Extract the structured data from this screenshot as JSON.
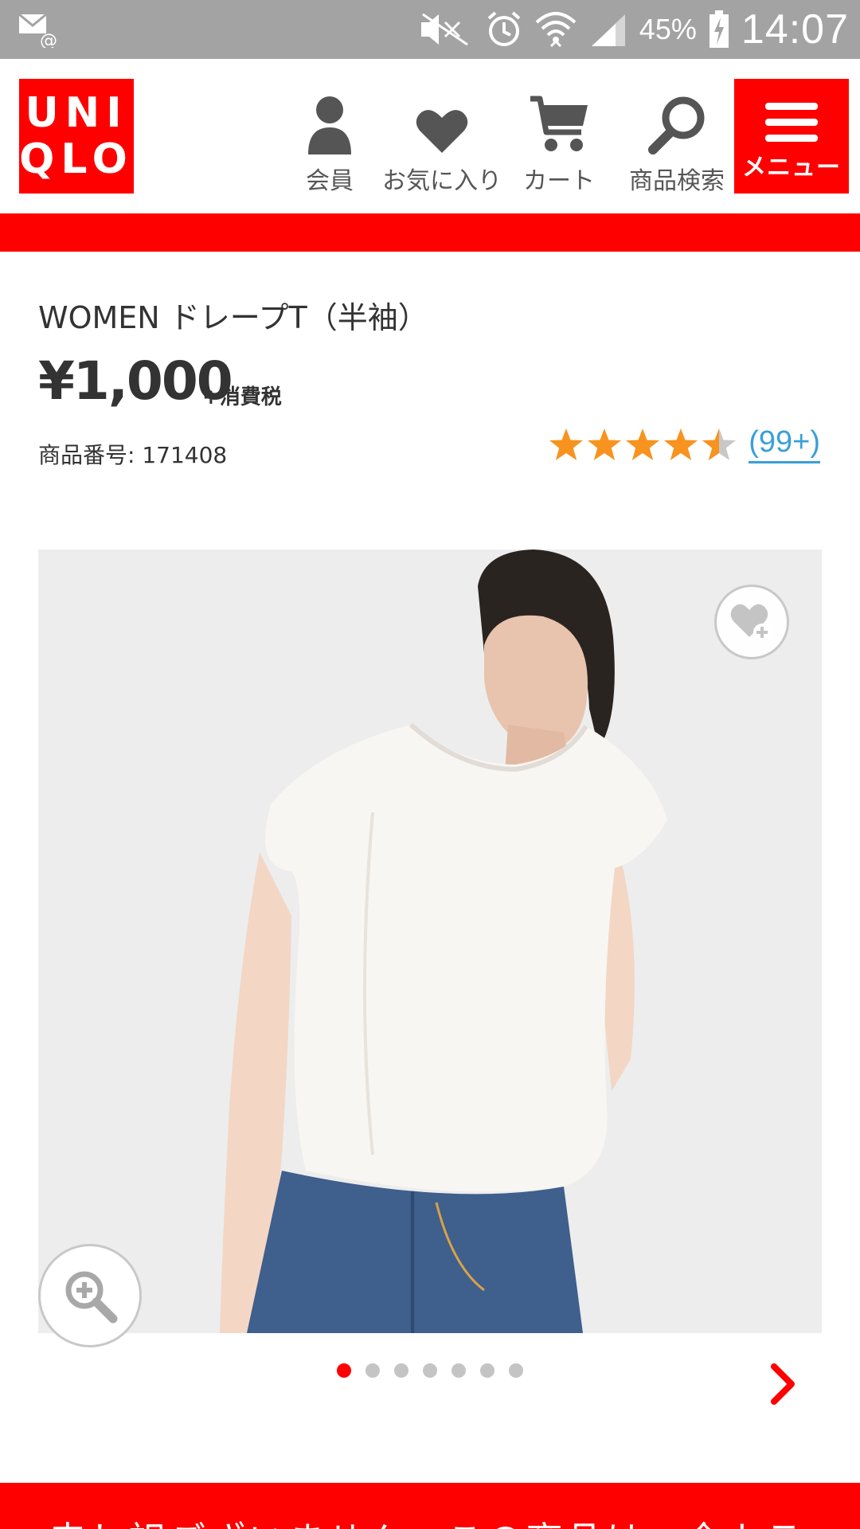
{
  "status_bar": {
    "battery": "45%",
    "time": "14:07"
  },
  "brand": {
    "logo_line1": "UNI",
    "logo_line2": "QLO",
    "color": "#ff0000"
  },
  "header_nav": [
    {
      "label": "会員",
      "icon": "person-icon"
    },
    {
      "label": "お気に入り",
      "icon": "heart-icon"
    },
    {
      "label": "カート",
      "icon": "cart-icon"
    },
    {
      "label": "商品検索",
      "icon": "search-icon"
    }
  ],
  "menu": {
    "label": "メニュー",
    "icon": "hamburger-icon"
  },
  "product": {
    "name": "WOMEN ドレープT（半袖）",
    "price": "¥1,000",
    "tax_note": "+消費税",
    "code_label": "商品番号: 171408",
    "rating": 4.5,
    "review_count": "(99+)"
  },
  "gallery": {
    "total_images": 7,
    "active_index": 0,
    "wishlist_icon": "heart-plus-icon",
    "zoom_icon": "zoom-in-icon",
    "next_icon": "chevron-right-icon"
  },
  "bottom_banner": {
    "text": "申し訳ございません。この商品は、全カラ"
  },
  "colors": {
    "accent": "#ff0000",
    "star": "#f7931e",
    "link": "#3aa0d8"
  }
}
